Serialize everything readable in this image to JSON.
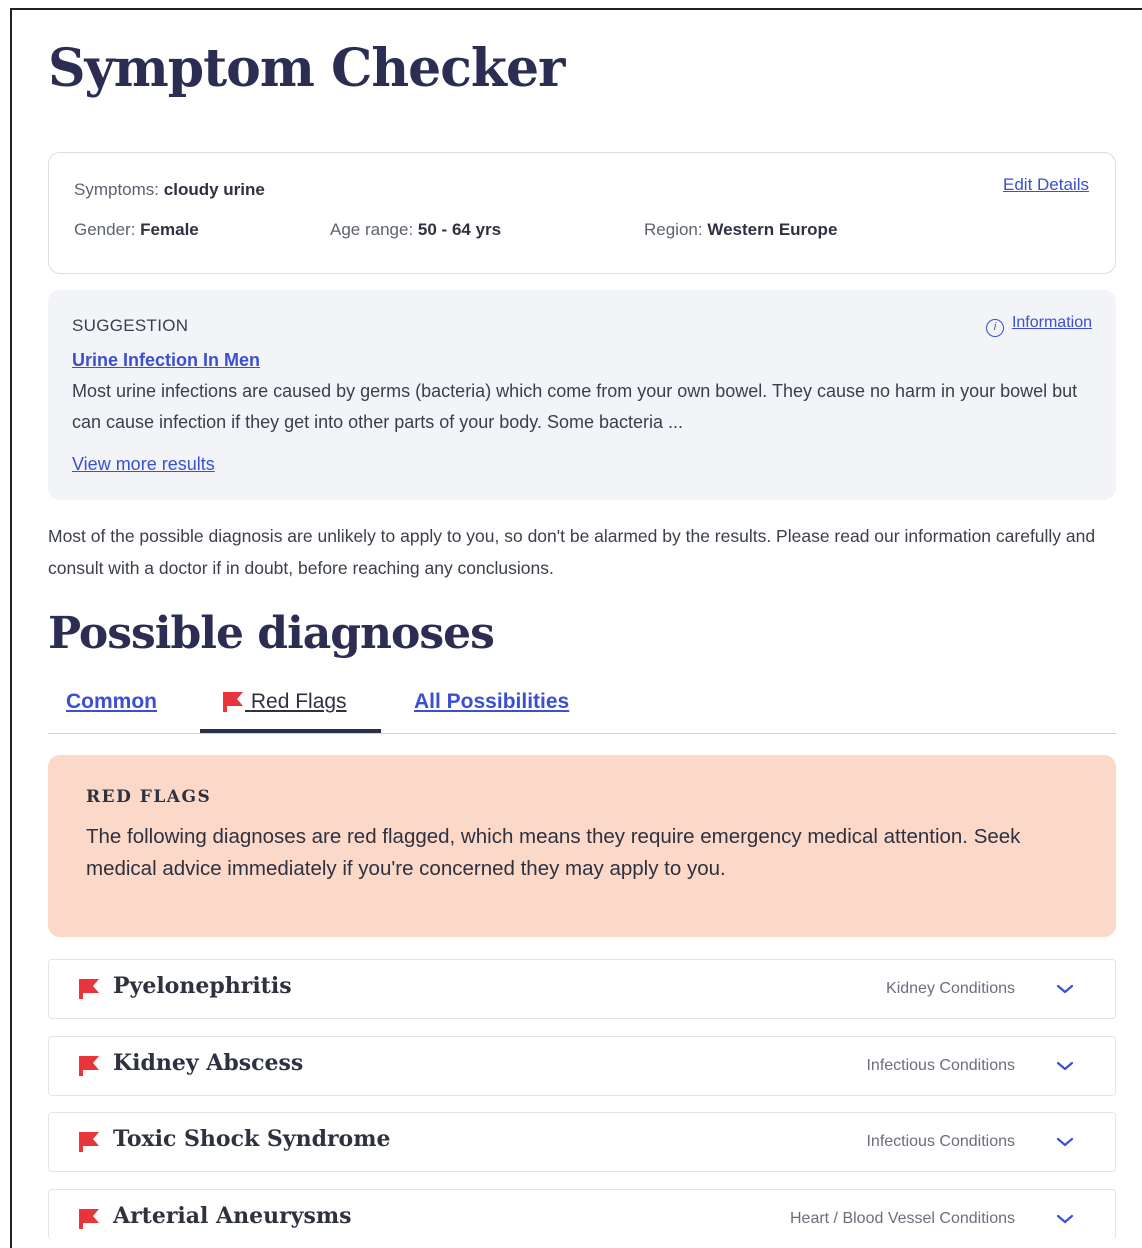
{
  "page": {
    "title": "Symptom Checker"
  },
  "details": {
    "symptoms_key": "Symptoms:",
    "symptoms_value": "cloudy urine",
    "gender_key": "Gender:",
    "gender_value": "Female",
    "age_key": "Age range:",
    "age_value": "50 - 64 yrs",
    "region_key": "Region:",
    "region_value": "Western Europe",
    "edit_label": "Edit Details"
  },
  "suggestion": {
    "label": "SUGGESTION",
    "info_label": "Information",
    "title": "Urine Infection In Men",
    "body": "Most urine infections are caused by germs (bacteria) which come from your own bowel. They cause no harm in your bowel but can cause infection if they get into other parts of your body. Some bacteria ...",
    "more_label": "View more results"
  },
  "notice": "Most of the possible diagnosis are unlikely to apply to you, so don't be alarmed by the results. Please read our information carefully and consult with a doctor if in doubt, before reaching any conclusions.",
  "diagnoses": {
    "heading": "Possible diagnoses",
    "tabs": [
      {
        "label": "Common"
      },
      {
        "label": "Red Flags"
      },
      {
        "label": "All Possibilities"
      }
    ],
    "active_tab": "Red Flags",
    "alert_title": "RED FLAGS",
    "alert_body": "The following diagnoses are red flagged, which means they require emergency medical attention. Seek medical advice immediately if you're concerned they may apply to you.",
    "items": [
      {
        "name": "Pyelonephritis",
        "category": "Kidney Conditions"
      },
      {
        "name": "Kidney Abscess",
        "category": "Infectious Conditions"
      },
      {
        "name": "Toxic Shock Syndrome",
        "category": "Infectious Conditions"
      },
      {
        "name": "Arterial Aneurysms",
        "category": "Heart / Blood Vessel Conditions"
      }
    ]
  },
  "icons": {
    "flag": "flag-icon",
    "info": "info-icon",
    "chevron": "chevron-down-icon"
  },
  "colors": {
    "accent": "#3b4fd1",
    "heading": "#2b2d52",
    "flag": "#e8343b",
    "alert_bg": "#fcd8c8"
  }
}
